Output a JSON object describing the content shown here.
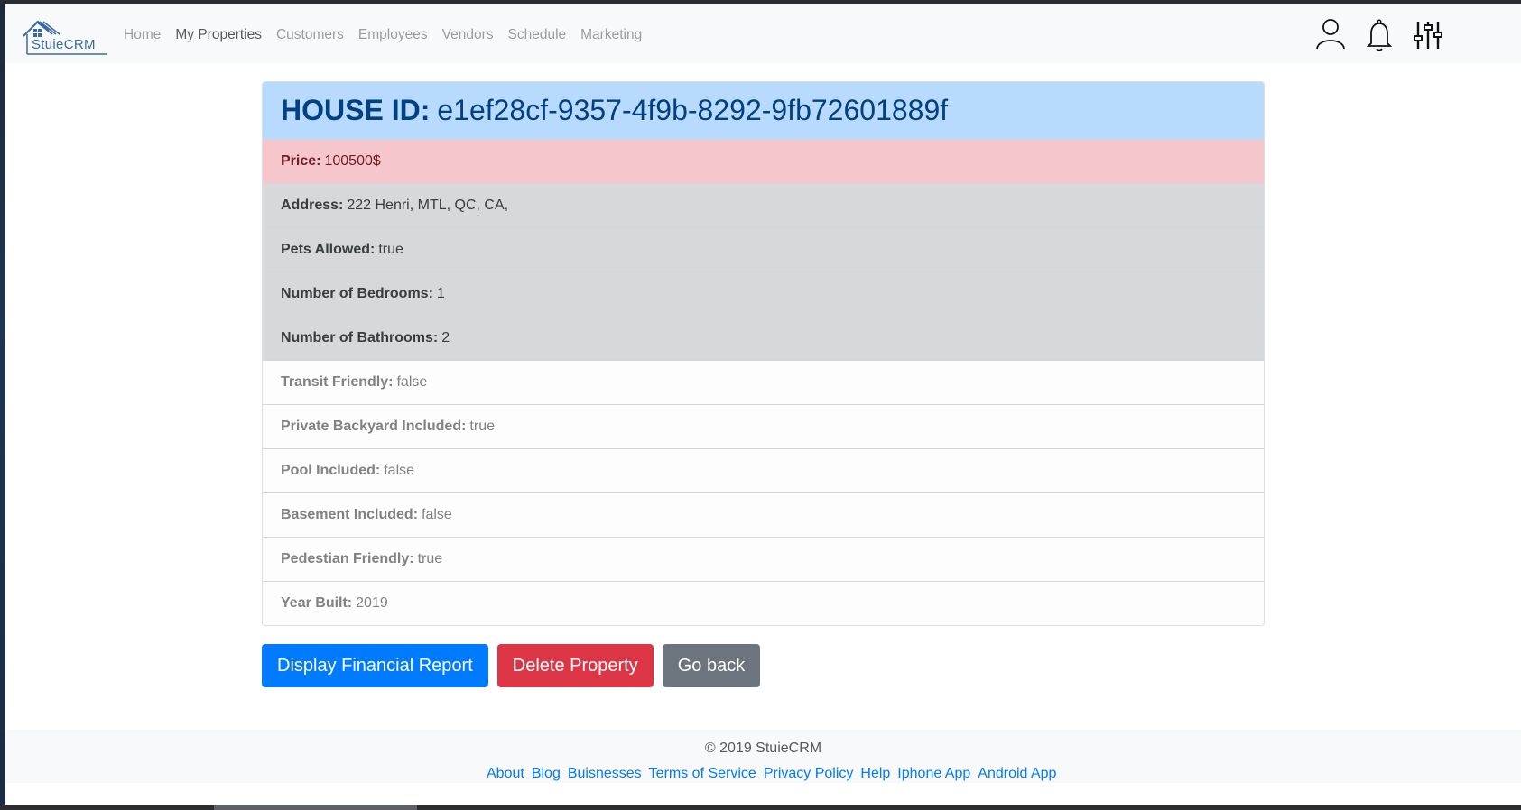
{
  "brand": {
    "name": "StuieCRM"
  },
  "nav": {
    "items": [
      "Home",
      "My Properties",
      "Customers",
      "Employees",
      "Vendors",
      "Schedule",
      "Marketing"
    ],
    "active": "My Properties",
    "icons": [
      "user-icon",
      "bell-icon",
      "sliders-icon"
    ]
  },
  "property": {
    "title_label": "HOUSE ID:",
    "house_id": "e1ef28cf-9357-4f9b-8292-9fb72601889f",
    "fields": [
      {
        "label": "Price:",
        "value": "100500$",
        "style": "danger"
      },
      {
        "label": "Address:",
        "value": "222 Henri, MTL, QC, CA,",
        "style": "secondary"
      },
      {
        "label": "Pets Allowed:",
        "value": "true",
        "style": "secondary"
      },
      {
        "label": "Number of Bedrooms:",
        "value": "1",
        "style": "secondary"
      },
      {
        "label": "Number of Bathrooms:",
        "value": "2",
        "style": "secondary"
      },
      {
        "label": "Transit Friendly:",
        "value": "false",
        "style": "plain"
      },
      {
        "label": "Private Backyard Included:",
        "value": "true",
        "style": "plain"
      },
      {
        "label": "Pool Included:",
        "value": "false",
        "style": "plain"
      },
      {
        "label": "Basement Included:",
        "value": "false",
        "style": "plain"
      },
      {
        "label": "Pedestian Friendly:",
        "value": "true",
        "style": "plain"
      },
      {
        "label": "Year Built:",
        "value": "2019",
        "style": "plain"
      }
    ]
  },
  "actions": {
    "financial_report": "Display Financial Report",
    "delete": "Delete Property",
    "go_back": "Go back"
  },
  "footer": {
    "copyright": "© 2019 StuieCRM",
    "links": [
      "About",
      "Blog",
      "Buisnesses",
      "Terms of Service",
      "Privacy Policy",
      "Help",
      "Iphone App",
      "Android App"
    ]
  },
  "colors": {
    "primary": "#007bff",
    "danger": "#dc3545",
    "secondary": "#6c757d",
    "title_bg": "#b8daff",
    "price_bg": "#f5c6cb",
    "gray_row_bg": "#d6d8db"
  }
}
